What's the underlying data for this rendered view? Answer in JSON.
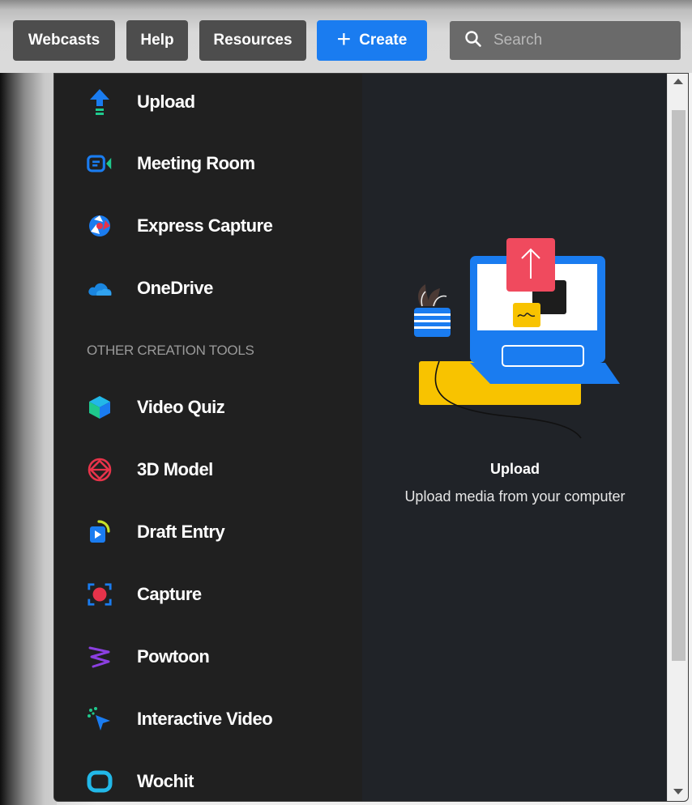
{
  "nav": {
    "webcasts": "Webcasts",
    "help": "Help",
    "resources": "Resources",
    "create": "Create",
    "search_placeholder": "Search"
  },
  "menu": {
    "primary": [
      {
        "label": "Upload",
        "icon": "upload-icon"
      },
      {
        "label": "Meeting Room",
        "icon": "meeting-room-icon"
      },
      {
        "label": "Express Capture",
        "icon": "express-capture-icon"
      },
      {
        "label": "OneDrive",
        "icon": "onedrive-icon"
      }
    ],
    "section_title": "OTHER CREATION TOOLS",
    "other": [
      {
        "label": "Video Quiz",
        "icon": "video-quiz-icon"
      },
      {
        "label": "3D Model",
        "icon": "3d-model-icon"
      },
      {
        "label": "Draft Entry",
        "icon": "draft-entry-icon"
      },
      {
        "label": "Capture",
        "icon": "capture-icon"
      },
      {
        "label": "Powtoon",
        "icon": "powtoon-icon"
      },
      {
        "label": "Interactive Video",
        "icon": "interactive-video-icon"
      },
      {
        "label": "Wochit",
        "icon": "wochit-icon"
      }
    ]
  },
  "preview": {
    "title": "Upload",
    "description": "Upload media from your computer"
  },
  "colors": {
    "accent": "#1a7cf0",
    "menu_bg": "#202020",
    "preview_bg": "#202328"
  }
}
